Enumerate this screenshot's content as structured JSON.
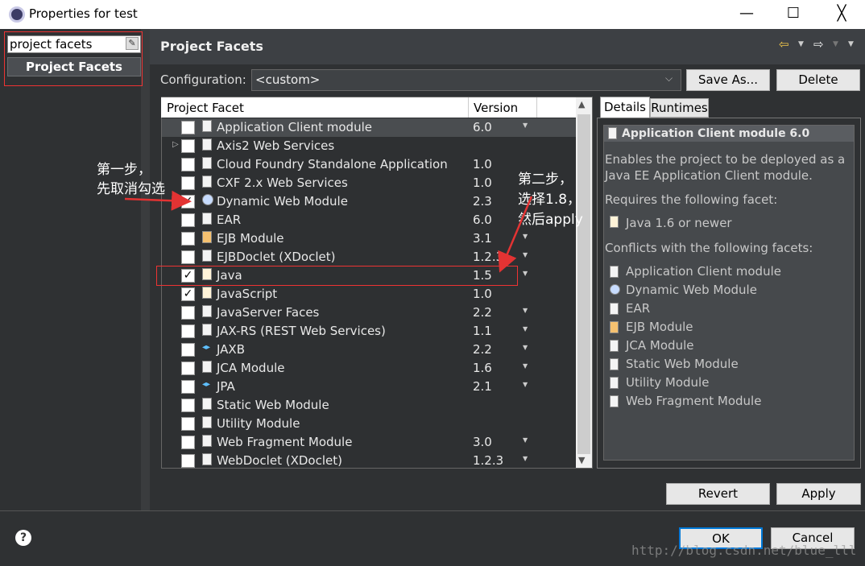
{
  "window": {
    "title": "Properties for test",
    "minimize": "—",
    "maximize": "☐",
    "close": "╳"
  },
  "left": {
    "filter_value": "project facets",
    "tree_item": "Project Facets",
    "clear_icon": "eraser-icon"
  },
  "header": {
    "title": "Project Facets",
    "back_icon": "arrow-left-icon",
    "forward_icon": "arrow-right-icon",
    "menu_icon": "chevron-down-icon"
  },
  "config": {
    "label": "Configuration:",
    "value": "<custom>",
    "save_as": "Save As...",
    "delete": "Delete"
  },
  "table": {
    "col_facet": "Project Facet",
    "col_version": "Version",
    "rows": [
      {
        "name": "Application Client module",
        "version": "6.0",
        "checked": false,
        "dropdown": true,
        "icon": "page"
      },
      {
        "name": "Axis2 Web Services",
        "version": "",
        "checked": false,
        "dropdown": false,
        "icon": "page",
        "expander": true
      },
      {
        "name": "Cloud Foundry Standalone Application",
        "version": "1.0",
        "checked": false,
        "dropdown": false,
        "icon": "page"
      },
      {
        "name": "CXF 2.x Web Services",
        "version": "1.0",
        "checked": false,
        "dropdown": false,
        "icon": "page"
      },
      {
        "name": "Dynamic Web Module",
        "version": "2.3",
        "checked": true,
        "dropdown": false,
        "icon": "web"
      },
      {
        "name": "EAR",
        "version": "6.0",
        "checked": false,
        "dropdown": false,
        "icon": "page"
      },
      {
        "name": "EJB Module",
        "version": "3.1",
        "checked": false,
        "dropdown": true,
        "icon": "ejb"
      },
      {
        "name": "EJBDoclet (XDoclet)",
        "version": "1.2.3",
        "checked": false,
        "dropdown": true,
        "icon": "page"
      },
      {
        "name": "Java",
        "version": "1.5",
        "checked": true,
        "dropdown": true,
        "icon": "java"
      },
      {
        "name": "JavaScript",
        "version": "1.0",
        "checked": true,
        "dropdown": false,
        "icon": "java"
      },
      {
        "name": "JavaServer Faces",
        "version": "2.2",
        "checked": false,
        "dropdown": true,
        "icon": "page"
      },
      {
        "name": "JAX-RS (REST Web Services)",
        "version": "1.1",
        "checked": false,
        "dropdown": true,
        "icon": "page"
      },
      {
        "name": "JAXB",
        "version": "2.2",
        "checked": false,
        "dropdown": true,
        "icon": "arrows"
      },
      {
        "name": "JCA Module",
        "version": "1.6",
        "checked": false,
        "dropdown": true,
        "icon": "page"
      },
      {
        "name": "JPA",
        "version": "2.1",
        "checked": false,
        "dropdown": true,
        "icon": "arrows"
      },
      {
        "name": "Static Web Module",
        "version": "",
        "checked": false,
        "dropdown": false,
        "icon": "page"
      },
      {
        "name": "Utility Module",
        "version": "",
        "checked": false,
        "dropdown": false,
        "icon": "page"
      },
      {
        "name": "Web Fragment Module",
        "version": "3.0",
        "checked": false,
        "dropdown": true,
        "icon": "page"
      },
      {
        "name": "WebDoclet (XDoclet)",
        "version": "1.2.3",
        "checked": false,
        "dropdown": true,
        "icon": "page"
      }
    ]
  },
  "details": {
    "tab_details": "Details",
    "tab_runtimes": "Runtimes",
    "title": "Application Client module 6.0",
    "description": "Enables the project to be deployed as a Java EE Application Client module.",
    "requires_label": "Requires the following facet:",
    "requires": [
      "Java 1.6 or newer"
    ],
    "conflicts_label": "Conflicts with the following facets:",
    "conflicts": [
      {
        "name": "Application Client module",
        "icon": "page"
      },
      {
        "name": "Dynamic Web Module",
        "icon": "web"
      },
      {
        "name": "EAR",
        "icon": "page"
      },
      {
        "name": "EJB Module",
        "icon": "ejb"
      },
      {
        "name": "JCA Module",
        "icon": "page"
      },
      {
        "name": "Static Web Module",
        "icon": "page"
      },
      {
        "name": "Utility Module",
        "icon": "page"
      },
      {
        "name": "Web Fragment Module",
        "icon": "page"
      }
    ]
  },
  "buttons": {
    "revert": "Revert",
    "apply": "Apply",
    "ok": "OK",
    "cancel": "Cancel",
    "help": "?"
  },
  "annotations": {
    "step1_line1": "第一步，",
    "step1_line2": "先取消勾选",
    "step2_line1": "第二步，",
    "step2_line2": "选择1.8，",
    "step2_line3": "然后apply"
  },
  "watermark": "http://blog.csdn.net/blue_lll",
  "colors": {
    "annotation_red": "#e33333",
    "dialog_dark": "#2f3133"
  }
}
